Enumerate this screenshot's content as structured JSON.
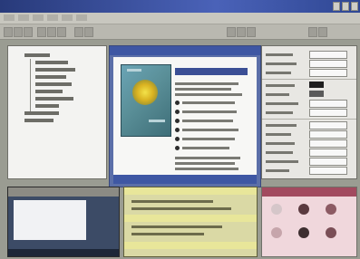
{
  "window": {
    "title": ""
  },
  "colors": {
    "accent": "#3e57a3",
    "tree_bg": "#f3f3f1",
    "dialog_bg": "#f7f7f5"
  },
  "panels": {
    "tree": {
      "label": ""
    },
    "dialog": {
      "title": ""
    },
    "properties": {
      "label": ""
    },
    "preview": {
      "label": ""
    },
    "output": {
      "label": ""
    },
    "tools": {
      "label": ""
    }
  }
}
